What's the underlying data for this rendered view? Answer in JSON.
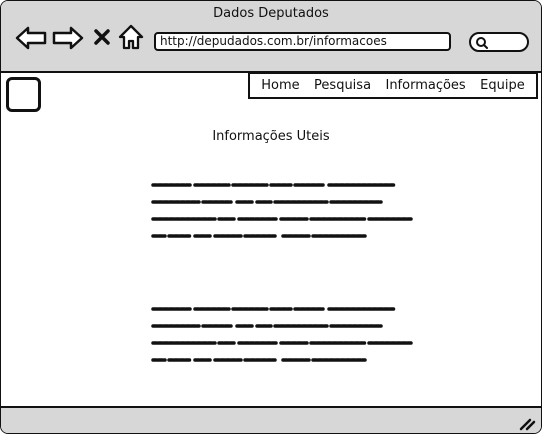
{
  "window": {
    "title": "Dados Deputados"
  },
  "toolbar": {
    "url": "http://depudados.com.br/informacoes",
    "icons": [
      "back-arrow-icon",
      "forward-arrow-icon",
      "close-x-icon",
      "home-icon",
      "search-icon"
    ]
  },
  "menu": {
    "items": [
      {
        "label": "Home"
      },
      {
        "label": "Pesquisa"
      },
      {
        "label": "Informações"
      },
      {
        "label": "Equipe"
      }
    ]
  },
  "content": {
    "heading": "Informações Uteis",
    "paragraphs": [
      "placeholder-scribble-text",
      "placeholder-scribble-text"
    ]
  },
  "colors": {
    "chrome": "#d7d7d7",
    "outline": "#111111",
    "background": "#ffffff"
  }
}
